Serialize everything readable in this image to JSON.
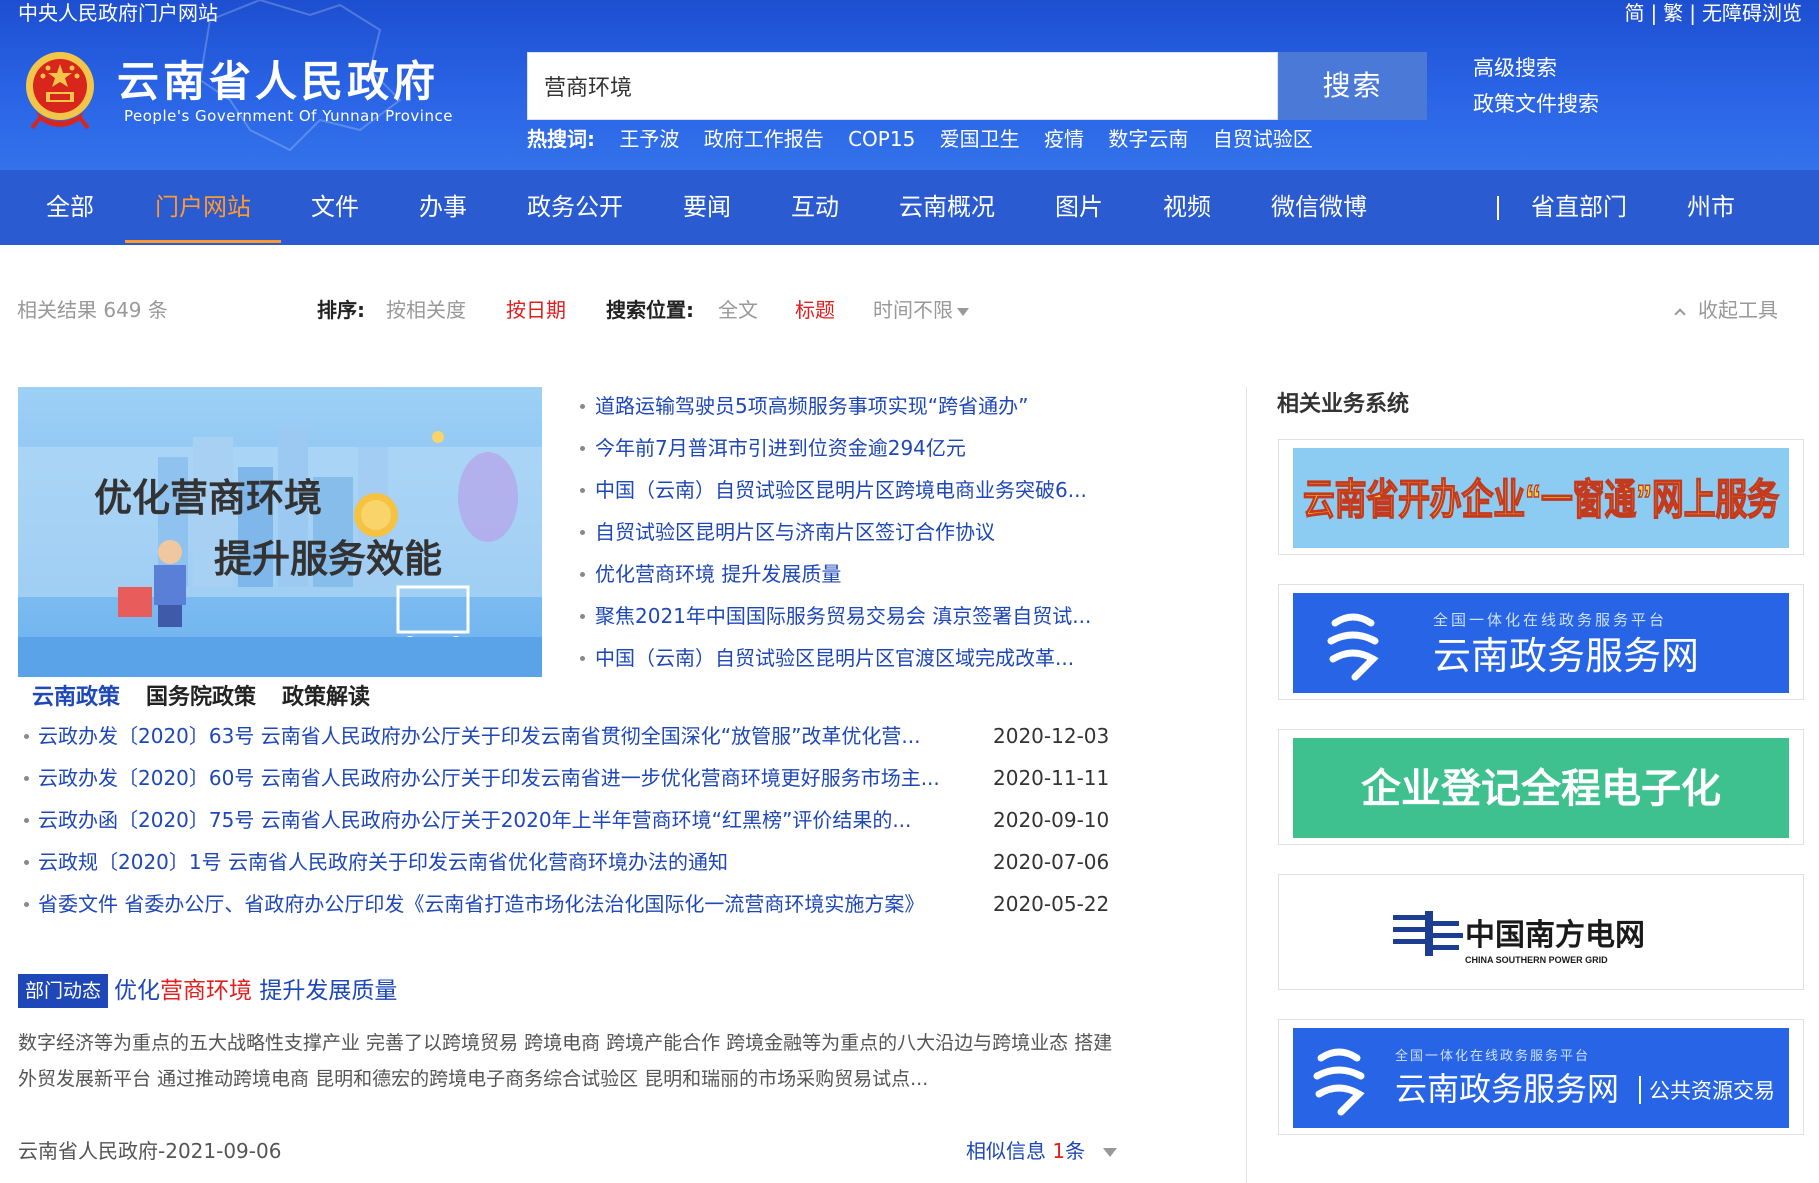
{
  "header": {
    "portal_link": "中央人民政府门户网站",
    "lang_simplified": "简",
    "lang_traditional": "繁",
    "accessibility": "无障碍浏览",
    "sep": "|",
    "site_title_cn": "云南省人民政府",
    "site_title_en": "People's Government Of Yunnan Province"
  },
  "search": {
    "value": "营商环境",
    "button": "搜索",
    "advanced": "高级搜索",
    "policy_search": "政策文件搜索",
    "hot_label": "热搜词:",
    "hot_words": [
      "王予波",
      "政府工作报告",
      "COP15",
      "爱国卫生",
      "疫情",
      "数字云南",
      "自贸试验区"
    ]
  },
  "nav": {
    "items": [
      "全部",
      "门户网站",
      "文件",
      "办事",
      "政务公开",
      "要闻",
      "互动",
      "云南概况",
      "图片",
      "视频",
      "微信微博"
    ],
    "right_items": [
      "省直部门",
      "州市"
    ],
    "active_index": 1
  },
  "filter": {
    "result_count": "相关结果 649 条",
    "sort_label": "排序:",
    "sort_relevance": "按相关度",
    "sort_date": "按日期",
    "position_label": "搜索位置:",
    "position_fulltext": "全文",
    "position_title": "标题",
    "time_range": "时间不限",
    "collapse_tools": "收起工具"
  },
  "featured": {
    "image_line1": "优化营商环境",
    "image_line2": "提升服务效能",
    "news": [
      "道路运输驾驶员5项高频服务事项实现“跨省通办”",
      "今年前7月普洱市引进到位资金逾294亿元",
      "中国（云南）自贸试验区昆明片区跨境电商业务突破6...",
      "自贸试验区昆明片区与济南片区签订合作协议",
      "优化营商环境 提升发展质量",
      "聚焦2021年中国国际服务贸易交易会 滇京签署自贸试...",
      "中国（云南）自贸试验区昆明片区官渡区域完成改革..."
    ]
  },
  "policy": {
    "tabs": [
      "云南政策",
      "国务院政策",
      "政策解读"
    ],
    "rows": [
      {
        "title": "云政办发〔2020〕63号 云南省人民政府办公厅关于印发云南省贯彻全国深化“放管服”改革优化营...",
        "date": "2020-12-03"
      },
      {
        "title": "云政办发〔2020〕60号 云南省人民政府办公厅关于印发云南省进一步优化营商环境更好服务市场主...",
        "date": "2020-11-11"
      },
      {
        "title": "云政办函〔2020〕75号 云南省人民政府办公厅关于2020年上半年营商环境“红黑榜”评价结果的...",
        "date": "2020-09-10"
      },
      {
        "title": "云政规〔2020〕1号 云南省人民政府关于印发云南省优化营商环境办法的通知",
        "date": "2020-07-06"
      },
      {
        "title": "省委文件 省委办公厅、省政府办公厅印发《云南省打造市场化法治化国际化一流营商环境实施方案》",
        "date": "2020-05-22"
      }
    ]
  },
  "article": {
    "badge": "部门动态",
    "title_pre": "优化",
    "title_hl": "营商环境",
    "title_post": " 提升发展质量",
    "body": "数字经济等为重点的五大战略性支撑产业 完善了以跨境贸易 跨境电商 跨境产能合作 跨境金融等为重点的八大沿边与跨境业态 搭建外贸发展新平台 通过推动跨境电商 昆明和德宏的跨境电子商务综合试验区 昆明和瑞丽的市场采购贸易试点...",
    "source": "云南省人民政府-2021-09-06",
    "similar_pre": "相似信息 ",
    "similar_num": "1",
    "similar_post": "条"
  },
  "right_panel": {
    "title": "相关业务系统",
    "cards": [
      {
        "text": "云南省开办企业“一窗通”网上服务"
      },
      {
        "small": "全国一体化在线政务服务平台",
        "text": "云南政务服务网"
      },
      {
        "text": "企业登记全程电子化"
      },
      {
        "text": "中国南方电网",
        "en": "CHINA SOUTHERN POWER GRID"
      },
      {
        "small": "全国一体化在线政务服务平台",
        "text": "云南政务服务网",
        "suffix": "公共资源交易"
      }
    ]
  },
  "colors": {
    "header_blue": "#2a64e6",
    "nav_blue": "#2b5bd1",
    "link_blue": "#1e47b8",
    "accent_orange": "#ff9a2e",
    "highlight_red": "#e02020"
  }
}
